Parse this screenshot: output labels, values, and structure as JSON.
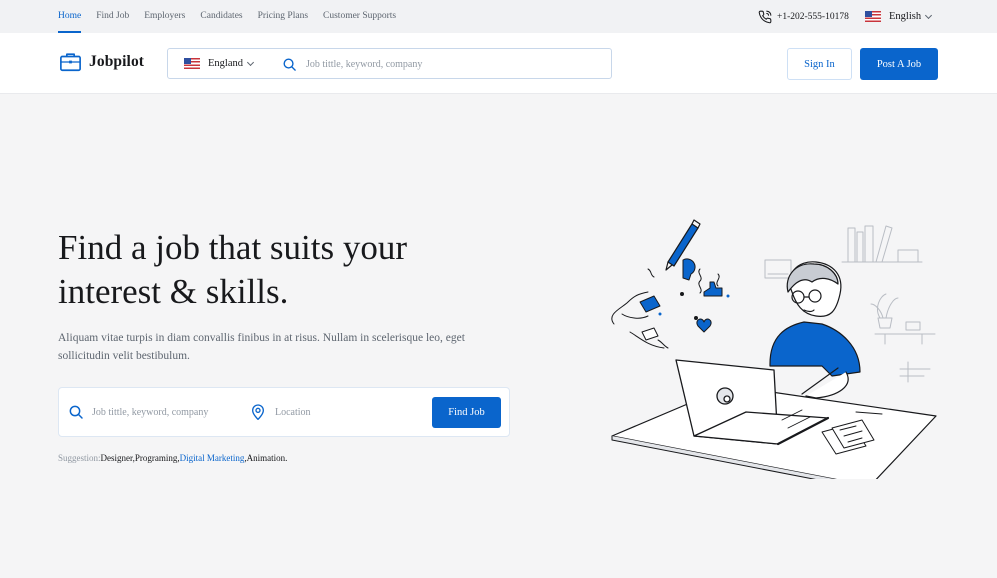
{
  "topnav": {
    "items": [
      {
        "label": "Home",
        "active": true
      },
      {
        "label": "Find Job",
        "active": false
      },
      {
        "label": "Employers",
        "active": false
      },
      {
        "label": "Candidates",
        "active": false
      },
      {
        "label": "Pricing Plans",
        "active": false
      },
      {
        "label": "Customer Supports",
        "active": false
      }
    ],
    "phone": "+1-202-555-10178",
    "language": "English"
  },
  "header": {
    "logo_text": "Jobpilot",
    "country": "England",
    "search_placeholder": "Job tittle, keyword, company",
    "signin_label": "Sign In",
    "post_job_label": "Post A Job"
  },
  "hero": {
    "title_line1": "Find a job that suits your",
    "title_line2": "interest & skills.",
    "description": "Aliquam vitae turpis in diam convallis finibus in at risus. Nullam in scelerisque leo, eget sollicitudin velit bestibulum.",
    "keyword_placeholder": "Job tittle, keyword, company",
    "location_placeholder": "Location",
    "find_job_label": "Find Job",
    "suggestion_label": "Suggestion:",
    "suggestions": [
      {
        "label": "Designer,",
        "highlight": false
      },
      {
        "label": "Programing,",
        "highlight": false
      },
      {
        "label": "Digital Marketing",
        "highlight": true
      },
      {
        "label": ",Animation.",
        "highlight": false
      }
    ]
  },
  "colors": {
    "primary": "#0a65cc",
    "background": "#f5f5f6",
    "topbar": "#f1f2f4"
  },
  "icons": [
    "phone-icon",
    "us-flag-icon",
    "chevron-down-icon",
    "briefcase-icon",
    "search-icon",
    "location-pin-icon"
  ]
}
